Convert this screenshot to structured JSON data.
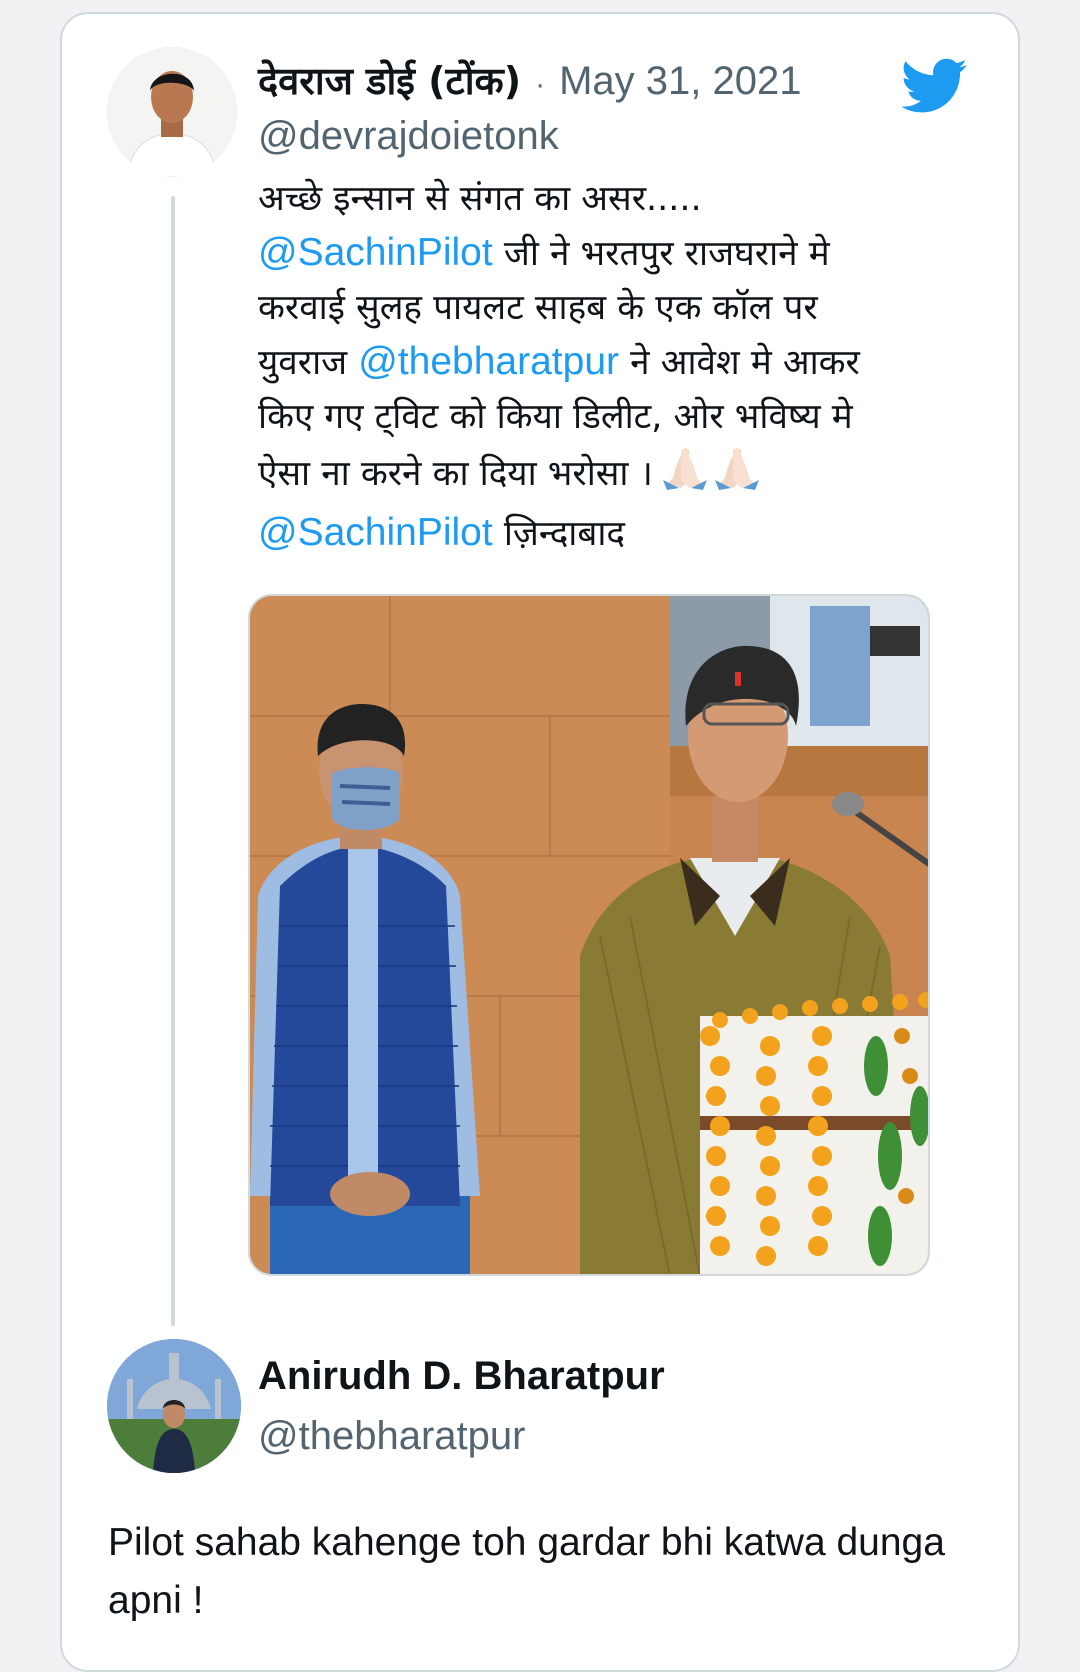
{
  "tweet": {
    "author_name": "देवराज डोई (टोंक)",
    "separator": "·",
    "date": "May 31, 2021",
    "handle": "@devrajdoietonk",
    "text_lines": [
      [
        {
          "t": "अच्छे इन्सान से संगत का असर....."
        }
      ],
      [
        {
          "t": "@SachinPilot",
          "m": true
        },
        {
          "t": " जी ने भरतपुर राजघराने मे"
        }
      ],
      [
        {
          "t": "करवाई सुलह पायलट साहब के एक कॉल पर"
        }
      ],
      [
        {
          "t": "युवराज "
        },
        {
          "t": "@thebharatpur",
          "m": true
        },
        {
          "t": " ने आवेश मे आकर"
        }
      ],
      [
        {
          "t": "किए गए ट्विट को किया डिलीट, ओर भविष्य मे"
        }
      ],
      [
        {
          "t": "ऐसा ना करने का दिया भरोसा ।"
        }
      ],
      [
        {
          "t": "@SachinPilot",
          "m": true
        },
        {
          "t": " ज़िन्दाबाद"
        }
      ]
    ],
    "emoji": "folded-hands-x2"
  },
  "reply": {
    "author_name": "Anirudh D. Bharatpur",
    "handle": "@thebharatpur",
    "text": "Pilot sahab kahenge toh gardar bhi katwa dunga apni !"
  },
  "icons": {
    "brand": "twitter-bird-icon"
  },
  "colors": {
    "link": "#1d9bf0",
    "secondary_text": "#536471",
    "border": "#cfd9de"
  }
}
